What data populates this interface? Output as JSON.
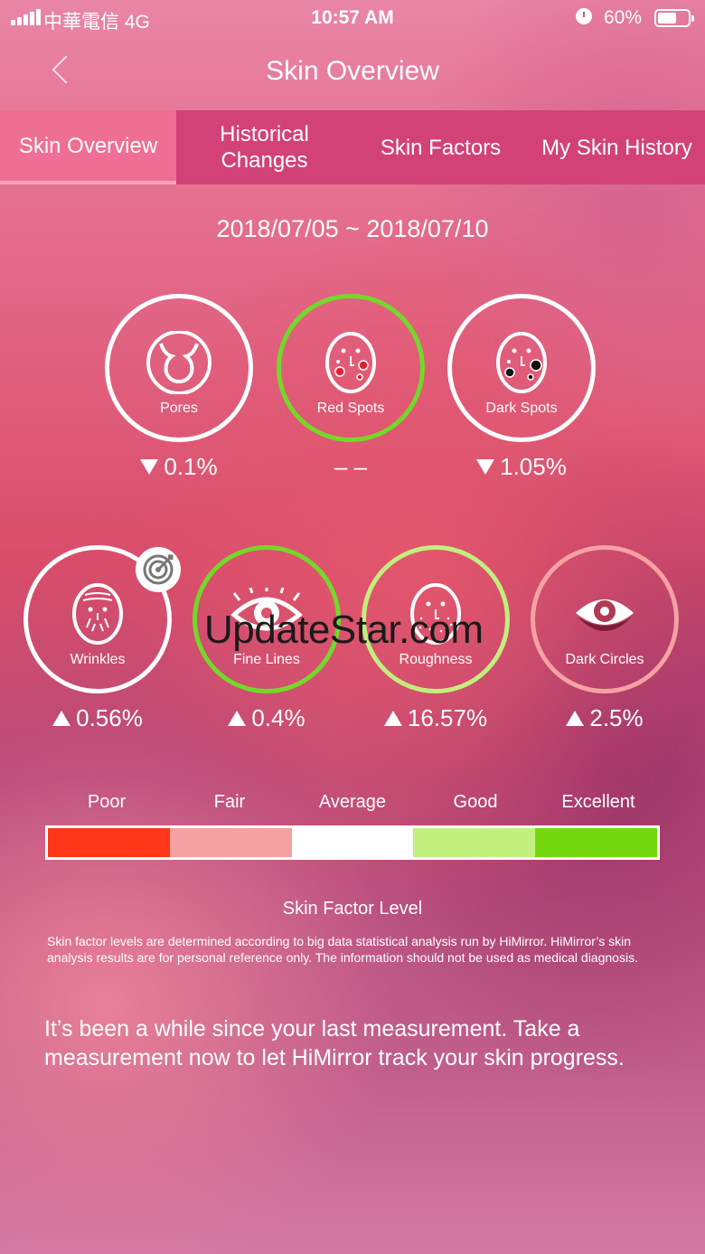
{
  "status_bar": {
    "carrier": "中華電信   4G",
    "time": "10:57 AM",
    "battery": "60%"
  },
  "header": {
    "title": "Skin Overview"
  },
  "tabs": [
    {
      "label": "Skin Overview",
      "active": true
    },
    {
      "label": "Historical Changes",
      "active": false
    },
    {
      "label": "Skin Factors",
      "active": false
    },
    {
      "label": "My Skin History",
      "active": false
    }
  ],
  "date_range": "2018/07/05 ~ 2018/07/10",
  "factors": [
    {
      "label": "Pores",
      "change": "0.1%",
      "trend": "down",
      "icon": "pores-icon",
      "level": "average"
    },
    {
      "label": "Red Spots",
      "change": "– –",
      "trend": "none",
      "icon": "red-spots-face-icon",
      "level": "excellent"
    },
    {
      "label": "Dark Spots",
      "change": "1.05%",
      "trend": "down",
      "icon": "dark-spots-face-icon",
      "level": "average"
    },
    {
      "label": "Wrinkles",
      "change": "0.56%",
      "trend": "up",
      "icon": "wrinkles-face-icon",
      "level": "average",
      "badge": "target-icon"
    },
    {
      "label": "Fine Lines",
      "change": "0.4%",
      "trend": "up",
      "icon": "eye-icon",
      "level": "excellent"
    },
    {
      "label": "Roughness",
      "change": "16.57%",
      "trend": "up",
      "icon": "roughness-face-icon",
      "level": "good"
    },
    {
      "label": "Dark Circles",
      "change": "2.5%",
      "trend": "up",
      "icon": "dark-circles-eye-icon",
      "level": "fair"
    }
  ],
  "levels": {
    "labels": [
      "Poor",
      "Fair",
      "Average",
      "Good",
      "Excellent"
    ],
    "colors": [
      "#ff3618",
      "#f6a1a1",
      "#ffffff",
      "#c2f07f",
      "#74d80f"
    ],
    "caption": "Skin Factor Level"
  },
  "colors": {
    "excellent": "#74d82a",
    "good": "#c2ee7e",
    "fair": "#f6a1a3",
    "tab_bar": "#d24276",
    "tab_active": "#ef6e93"
  },
  "disclaimer": "Skin factor levels are determined according to big data statistical analysis run by HiMirror. HiMirror’s skin analysis results are for personal reference only. The information should not be used as medical diagnosis.",
  "reminder": "It’s been a while since your last measurement. Take a measurement now to let HiMirror track your skin progress.",
  "watermark": "UpdateStar.com"
}
